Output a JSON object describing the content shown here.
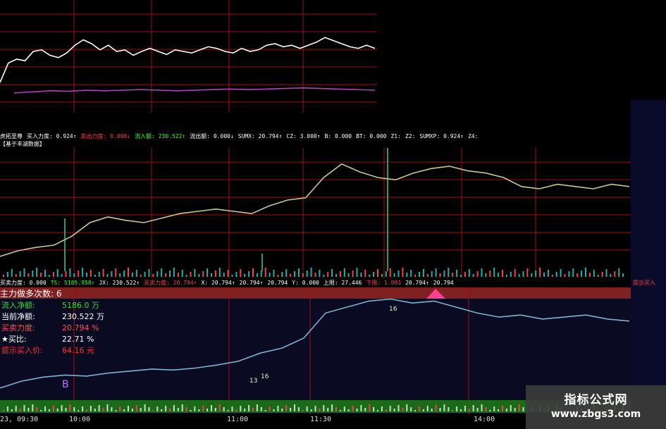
{
  "indicator_bar": {
    "items": [
      {
        "text": "虎拓至尊",
        "color": "#ffffff"
      },
      {
        "text": "买入力度: 0.924↑",
        "color": "#ffffff"
      },
      {
        "text": "卖出力度: 0.000↓",
        "color": "#ff4040"
      },
      {
        "text": "流入额: 230.522↑",
        "color": "#33ff33"
      },
      {
        "text": "流出额: 0.000↓",
        "color": "#ffffff"
      },
      {
        "text": "SUMX: 20.794↑",
        "color": "#ffffff"
      },
      {
        "text": "CZ: 3.000↑",
        "color": "#ffffff"
      },
      {
        "text": "B: 0.000",
        "color": "#ffffff"
      },
      {
        "text": "BT: 0.000",
        "color": "#ffffff"
      },
      {
        "text": "Z1:",
        "color": "#ffffff"
      },
      {
        "text": "Z2:",
        "color": "#ffffff"
      },
      {
        "text": "SUMXP: 0.924↑",
        "color": "#ffffff"
      },
      {
        "text": "Z4:",
        "color": "#ffffff"
      }
    ],
    "sub_label": "【基于丰湖数据】"
  },
  "buysell_bar": {
    "items": [
      {
        "text": "买卖力度: 0.000",
        "color": "#ffffff"
      },
      {
        "text": "TS: 5185.958↑",
        "color": "#33ff33"
      },
      {
        "text": "JX: 230.522↑",
        "color": "#ffffff"
      },
      {
        "text": "买卖力度: 20.794↑",
        "color": "#ff4040"
      },
      {
        "text": "X: 20.794↑",
        "color": "#ffffff"
      },
      {
        "text": "20.794↑",
        "color": "#ffffff"
      },
      {
        "text": "20.794",
        "color": "#ffffff"
      },
      {
        "text": "Y: 0.000",
        "color": "#ffffff"
      },
      {
        "text": "上限: 27.446",
        "color": "#ffffff"
      },
      {
        "text": "下限: 1.993",
        "color": "#ff4040"
      },
      {
        "text": "20.794↑",
        "color": "#ffffff"
      },
      {
        "text": "20.794",
        "color": "#ffffff"
      }
    ],
    "right_label": "提示买入"
  },
  "main_force": {
    "title_label": "主力做多次数:",
    "title_value": "6"
  },
  "stats": [
    {
      "label": "流入净额:",
      "value": "5186.0 万",
      "color": "#33dd33"
    },
    {
      "label": "当前净额:",
      "value": "230.522 万",
      "color": "#ffffff"
    },
    {
      "label": "买卖力度:",
      "value": "20.794 %",
      "color": "#ff5050"
    },
    {
      "label": "★买比:",
      "value": "22.71 %",
      "color": "#ffffff"
    },
    {
      "label": "提示买入价:",
      "value": "64.16 元",
      "color": "#ff3030"
    }
  ],
  "time_axis": {
    "start": "23, 09:30",
    "ticks": [
      "10:00",
      "11:00",
      "11:30",
      "14:00"
    ]
  },
  "markers": {
    "b_label": "B",
    "m1": "13",
    "m2": "16",
    "m3": "16"
  },
  "colors": {
    "price_line": "#ffffff",
    "avg_line": "#b040c0",
    "grid": "#a01010",
    "flow_line": "#c8c890",
    "cum_line": "#7ab4d0",
    "bar_up": "#ff4040",
    "bar_down": "#20b0b0",
    "band": "#802020",
    "band_bottom": "#1a6a1a"
  },
  "watermark": {
    "line1": "指标公式网",
    "line2": "www.zbgs3.com"
  },
  "chart_data": {
    "type": "line",
    "series": [
      {
        "values": [
          0.3,
          0.55,
          0.6,
          0.58,
          0.7,
          0.72,
          0.65,
          0.62,
          0.68,
          0.78,
          0.85,
          0.8,
          0.72,
          0.78,
          0.7,
          0.72,
          0.65,
          0.7,
          0.74,
          0.7,
          0.66,
          0.72,
          0.7,
          0.68,
          0.72,
          0.76,
          0.74,
          0.7,
          0.68,
          0.74,
          0.7,
          0.72,
          0.78,
          0.8,
          0.76,
          0.78,
          0.74,
          0.78,
          0.82,
          0.88,
          0.84,
          0.8,
          0.76,
          0.74,
          0.78,
          0.74
        ]
      },
      {
        "values": [
          0.1,
          0.15,
          0.18,
          0.2,
          0.28,
          0.4,
          0.45,
          0.42,
          0.4,
          0.44,
          0.48,
          0.5,
          0.52,
          0.5,
          0.48,
          0.55,
          0.6,
          0.62,
          0.8,
          0.92,
          0.85,
          0.8,
          0.78,
          0.84,
          0.88,
          0.9,
          0.86,
          0.84,
          0.8,
          0.72,
          0.7,
          0.74,
          0.72,
          0.7,
          0.74,
          0.72
        ]
      },
      {
        "values": [
          0.05,
          0.12,
          0.16,
          0.18,
          0.17,
          0.2,
          0.22,
          0.24,
          0.23,
          0.25,
          0.28,
          0.32,
          0.4,
          0.45,
          0.55,
          0.8,
          0.86,
          0.92,
          0.94,
          0.9,
          0.92,
          0.86,
          0.8,
          0.76,
          0.78,
          0.74,
          0.76,
          0.78,
          0.74,
          0.72
        ]
      }
    ]
  }
}
